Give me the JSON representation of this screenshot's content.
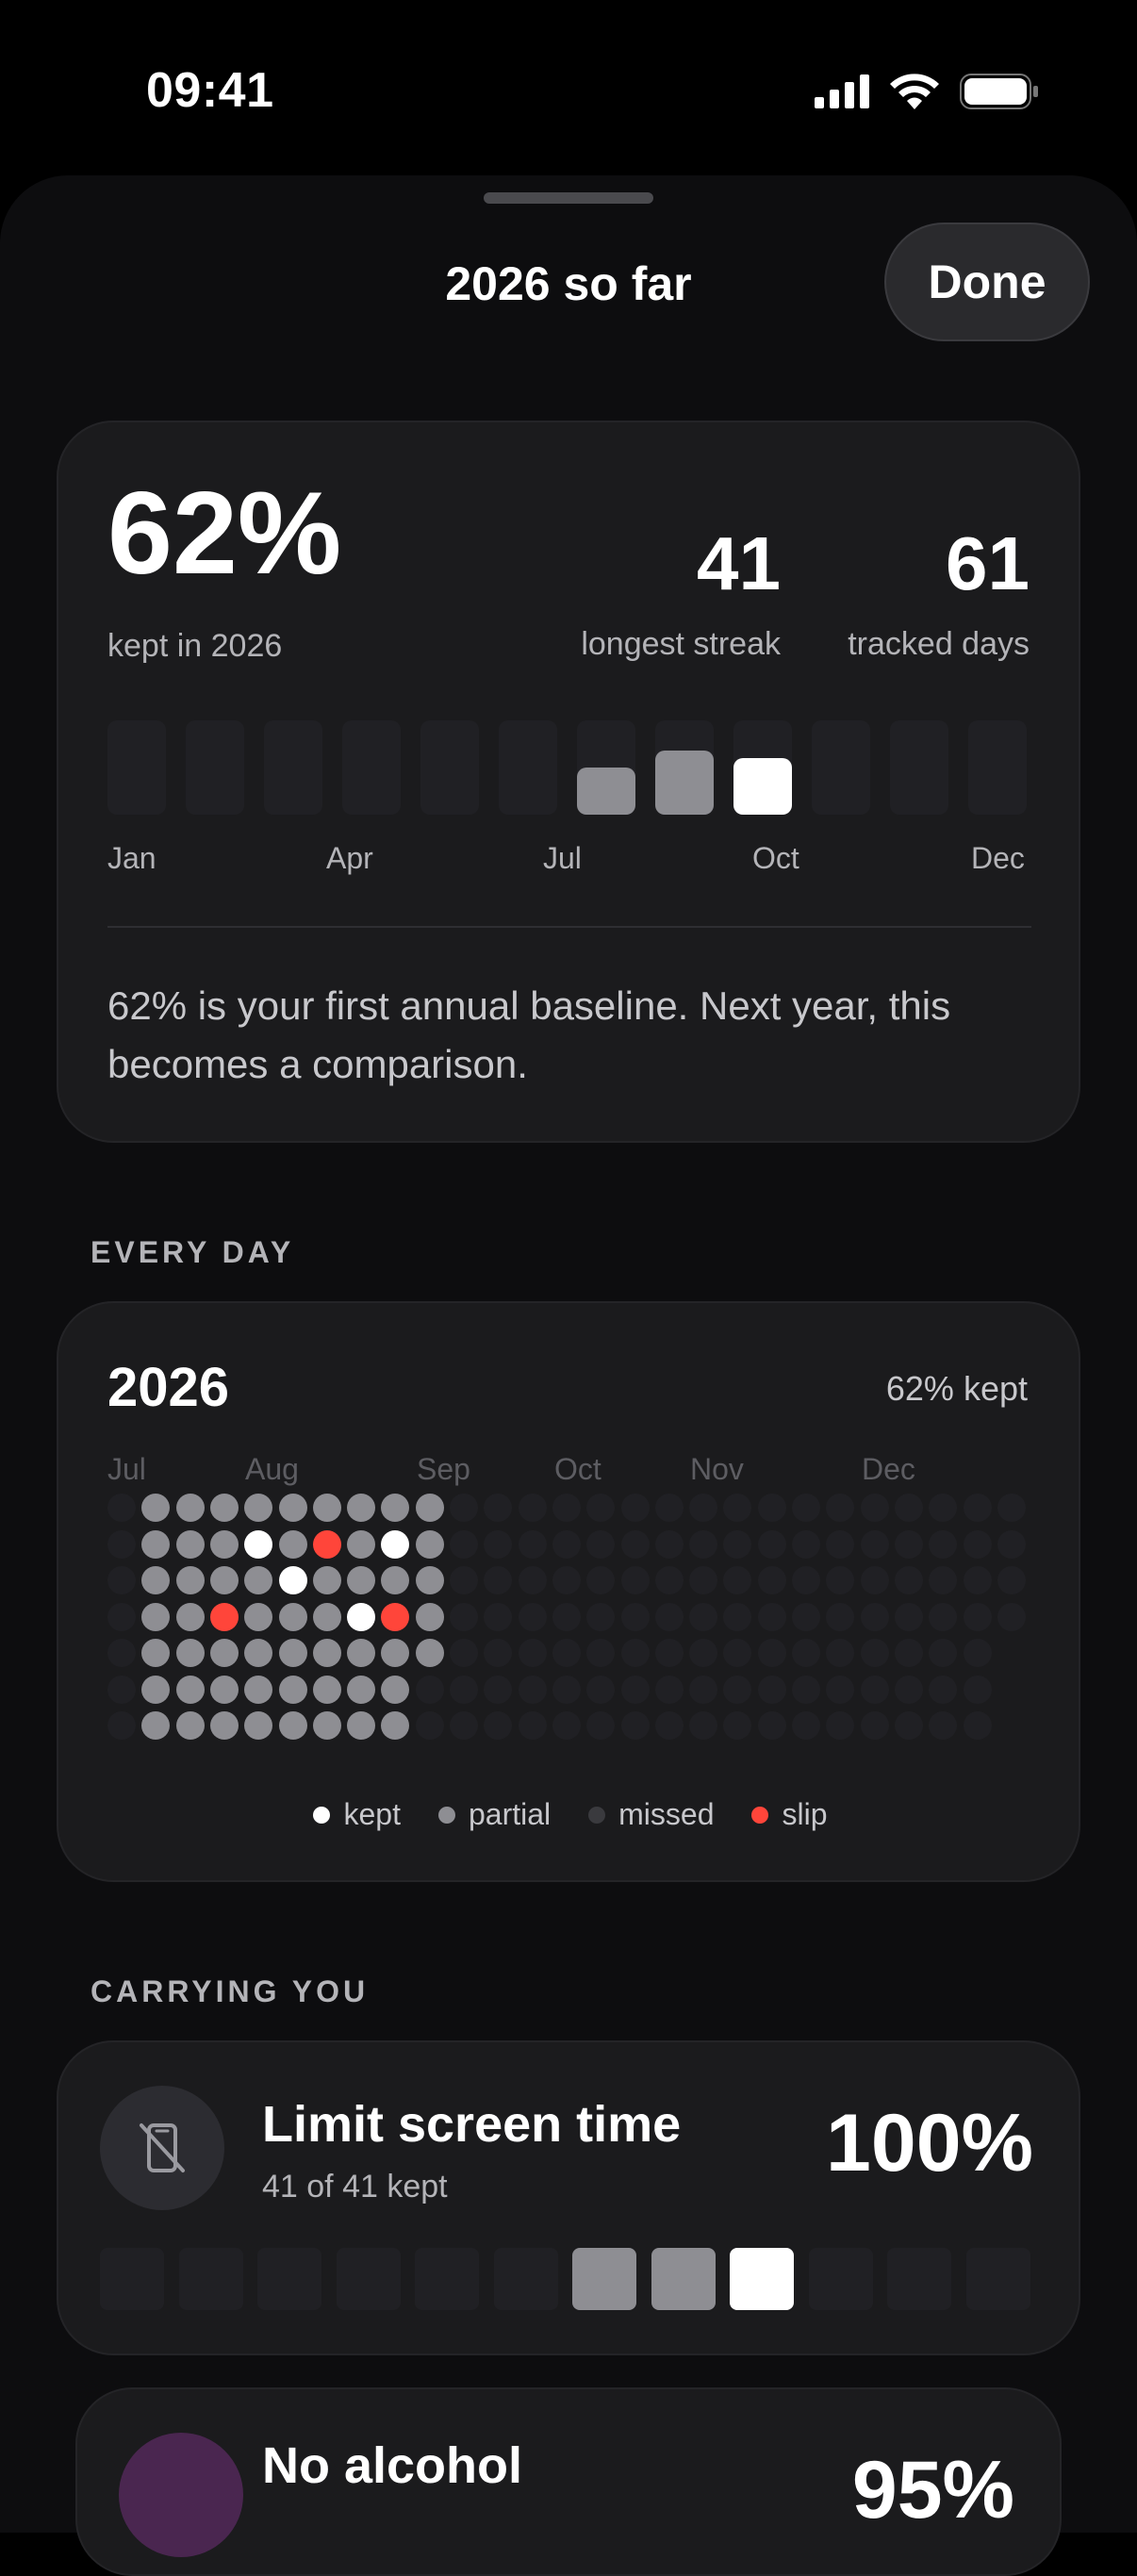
{
  "status_bar": {
    "time": "09:41"
  },
  "sheet": {
    "title": "2026 so far",
    "done_label": "Done"
  },
  "summary": {
    "percent": "62%",
    "percent_label": "kept in 2026",
    "streak": "41",
    "streak_label": "longest streak",
    "tracked": "61",
    "tracked_label": "tracked days",
    "month_labels": [
      "Jan",
      "Apr",
      "Jul",
      "Oct",
      "Dec"
    ],
    "monthly_levels": [
      0,
      0,
      0,
      0,
      0,
      0,
      0.5,
      0.68,
      0.6,
      0,
      0,
      0
    ],
    "monthly_colors": [
      "",
      "",
      "",
      "",
      "",
      "",
      "#8e8e93",
      "#8e8e93",
      "#ffffff",
      "",
      "",
      ""
    ],
    "note": "62% is your first annual baseline. Next year, this becomes a comparison."
  },
  "every_day": {
    "section_label": "EVERY DAY",
    "year": "2026",
    "kept_label": "62% kept",
    "month_labels": [
      "Jul",
      "Aug",
      "Sep",
      "Oct",
      "Nov",
      "Dec"
    ],
    "legend": [
      {
        "label": "kept",
        "color": "#ffffff"
      },
      {
        "label": "partial",
        "color": "#8e8e93"
      },
      {
        "label": "missed",
        "color": "#3a3a3e"
      },
      {
        "label": "slip",
        "color": "#ff453a"
      }
    ]
  },
  "carrying": {
    "section_label": "CARRYING YOU",
    "habits": [
      {
        "title": "Limit screen time",
        "subtitle": "41 of 41 kept",
        "percent": "100%",
        "icon": "phone-slash-icon",
        "monthly": [
          "",
          "",
          "",
          "",
          "",
          "",
          "#8e8e93",
          "#8e8e93",
          "#ffffff",
          "",
          "",
          ""
        ]
      },
      {
        "title": "No alcohol",
        "percent": "95%",
        "icon": "no-alcohol-icon"
      }
    ]
  },
  "colors": {
    "kept": "#ffffff",
    "partial": "#8e8e93",
    "missed": "#3a3a3e",
    "empty": "#202024",
    "slip": "#ff453a"
  }
}
